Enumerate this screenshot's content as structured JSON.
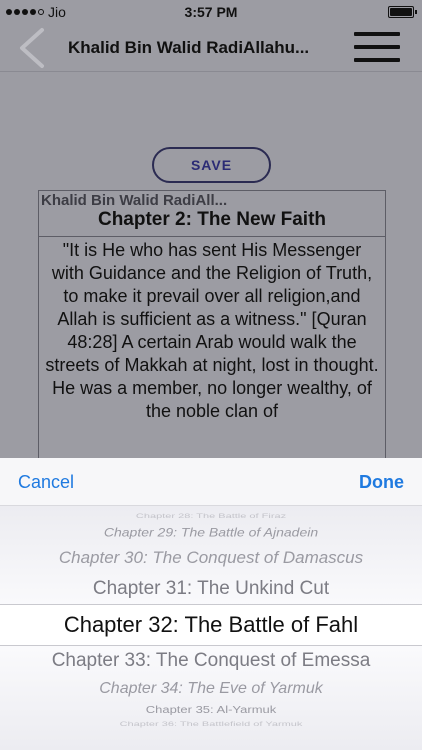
{
  "status_bar": {
    "carrier": "Jio",
    "time": "3:57 PM"
  },
  "nav": {
    "title": "Khalid Bin Walid RadiAllahu..."
  },
  "save_label": "SAVE",
  "book": {
    "title": "Khalid Bin Walid RadiAll...",
    "chapter": "Chapter 2: The New Faith",
    "text": "\"It is He who has sent His Messenger with Guidance and the Religion of Truth, to make it prevail over all religion,and Allah is sufficient as a witness.\" [Quran 48:28] A certain Arab would walk the streets of Makkah at night, lost in thought. He was a member, no longer wealthy, of the noble clan of"
  },
  "sheet": {
    "cancel": "Cancel",
    "done": "Done"
  },
  "picker": {
    "rows": [
      "Chapter 28: The Battle of Firaz",
      "Chapter 29: The Battle of Ajnadein",
      "Chapter 30: The Conquest of Damascus",
      "Chapter 31: The Unkind Cut",
      "Chapter 32: The Battle of Fahl",
      "Chapter 33: The Conquest of Emessa",
      "Chapter 34: The Eve of Yarmuk",
      "Chapter 35: Al-Yarmuk",
      "Chapter 36: The Battlefield of Yarmuk"
    ],
    "selected": "Chapter 32: The Battle of Fahl"
  }
}
